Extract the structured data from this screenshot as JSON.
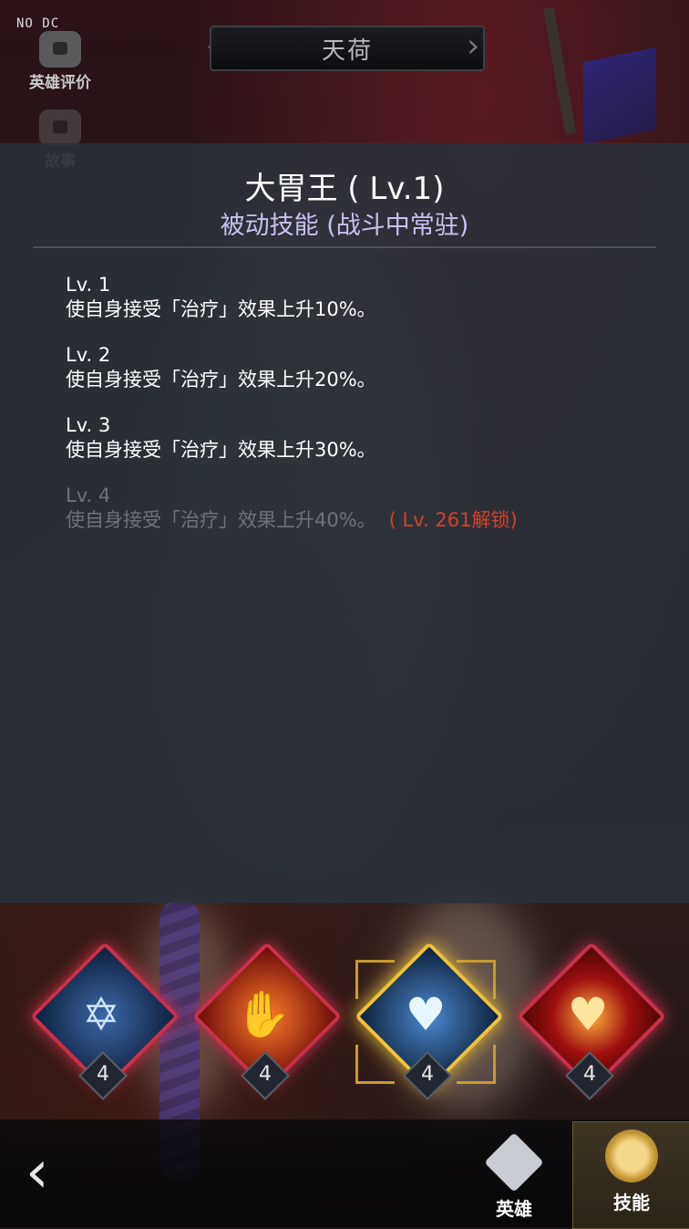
{
  "debug_label": "NO DC",
  "hero_name": "天荷",
  "side_menu": {
    "rating_label": "英雄评价",
    "story_label": "故事"
  },
  "skill_panel": {
    "title": "大胃王 ( Lv.1)",
    "subtitle": "被动技能 (战斗中常驻)",
    "levels": [
      {
        "level": "Lv. 1",
        "desc": "使自身接受「治疗」效果上升10%。",
        "locked": false
      },
      {
        "level": "Lv. 2",
        "desc": "使自身接受「治疗」效果上升20%。",
        "locked": false
      },
      {
        "level": "Lv. 3",
        "desc": "使自身接受「治疗」效果上升30%。",
        "locked": false
      },
      {
        "level": "Lv. 4",
        "desc": "使自身接受「治疗」效果上升40%。",
        "locked": true,
        "unlock_note": "( Lv. 261解锁)"
      }
    ]
  },
  "skills": [
    {
      "icon": "shield-star-icon",
      "level": "4",
      "color": "#1d3a6a",
      "glyph": "✡"
    },
    {
      "icon": "flame-hand-icon",
      "level": "4",
      "color": "#8a1a10",
      "glyph": "✋"
    },
    {
      "icon": "heart-plus-icon",
      "level": "4",
      "color": "#1a3f6a",
      "glyph": "♥",
      "selected": true
    },
    {
      "icon": "heart-glow-icon",
      "level": "4",
      "color": "#a0100e",
      "glyph": "♥"
    }
  ],
  "bottom_nav": {
    "back_label": "‹",
    "hero_tab": "英雄",
    "skill_tab": "技能"
  }
}
